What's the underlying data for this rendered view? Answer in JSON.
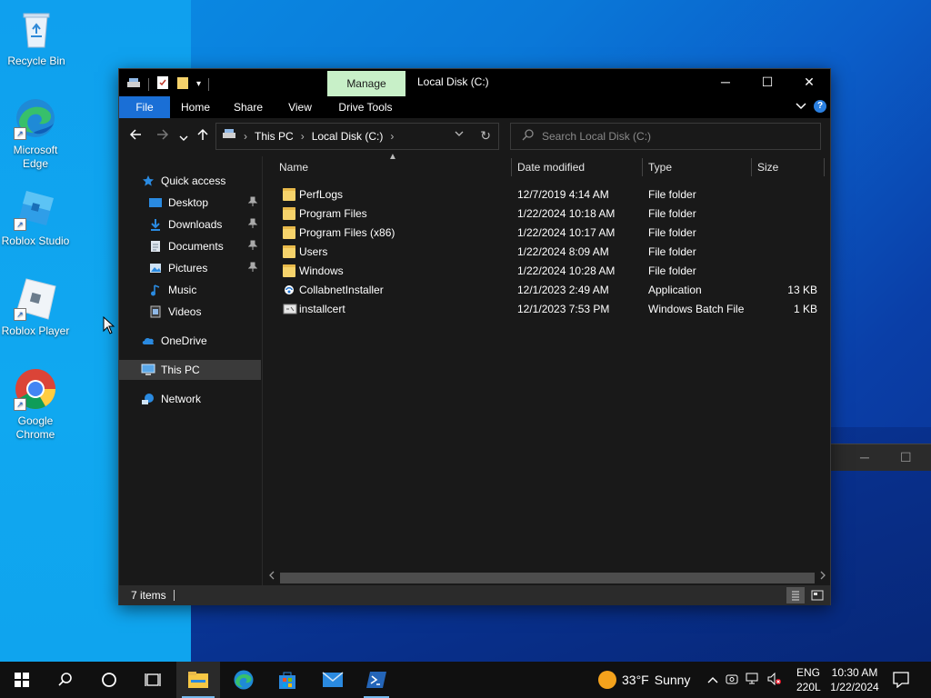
{
  "desktop": {
    "icons": [
      {
        "label": "Recycle Bin"
      },
      {
        "label": "Microsoft Edge"
      },
      {
        "label": "Roblox Studio"
      },
      {
        "label": "Roblox Player"
      },
      {
        "label": "Google Chrome"
      }
    ]
  },
  "explorer": {
    "title": "Local Disk (C:)",
    "contextual_tab": "Manage",
    "window_controls": {
      "minimize": "─",
      "maximize": "☐",
      "close": "✕"
    },
    "ribbon_tabs": [
      "File",
      "Home",
      "Share",
      "View",
      "Drive Tools"
    ],
    "address": {
      "crumbs": [
        "This PC",
        "Local Disk (C:)"
      ]
    },
    "search": {
      "placeholder": "Search Local Disk (C:)"
    },
    "nav_pane": {
      "quick_access": "Quick access",
      "pinned": [
        {
          "label": "Desktop",
          "pinned": true
        },
        {
          "label": "Downloads",
          "pinned": true
        },
        {
          "label": "Documents",
          "pinned": true
        },
        {
          "label": "Pictures",
          "pinned": true
        },
        {
          "label": "Music",
          "pinned": false
        },
        {
          "label": "Videos",
          "pinned": false
        }
      ],
      "onedrive": "OneDrive",
      "this_pc": "This PC",
      "network": "Network",
      "selected": "This PC"
    },
    "columns": [
      "Name",
      "Date modified",
      "Type",
      "Size"
    ],
    "files": [
      {
        "name": "PerfLogs",
        "date": "12/7/2019 4:14 AM",
        "type": "File folder",
        "size": "",
        "icon": "folder-icon"
      },
      {
        "name": "Program Files",
        "date": "1/22/2024 10:18 AM",
        "type": "File folder",
        "size": "",
        "icon": "folder-icon"
      },
      {
        "name": "Program Files (x86)",
        "date": "1/22/2024 10:17 AM",
        "type": "File folder",
        "size": "",
        "icon": "folder-icon"
      },
      {
        "name": "Users",
        "date": "1/22/2024 8:09 AM",
        "type": "File folder",
        "size": "",
        "icon": "folder-icon"
      },
      {
        "name": "Windows",
        "date": "1/22/2024 10:28 AM",
        "type": "File folder",
        "size": "",
        "icon": "folder-icon"
      },
      {
        "name": "CollabnetInstaller",
        "date": "12/1/2023 2:49 AM",
        "type": "Application",
        "size": "13 KB",
        "icon": "application-icon"
      },
      {
        "name": "installcert",
        "date": "12/1/2023 7:53 PM",
        "type": "Windows Batch File",
        "size": "1 KB",
        "icon": "batch-file-icon"
      }
    ],
    "status": {
      "item_count": "7 items"
    }
  },
  "taskbar": {
    "weather": {
      "temp": "33°F",
      "condition": "Sunny"
    },
    "language": {
      "line1": "ENG",
      "line2": "220L"
    },
    "clock": {
      "time": "10:30 AM",
      "date": "1/22/2024"
    },
    "accent": "#76b9ed"
  }
}
